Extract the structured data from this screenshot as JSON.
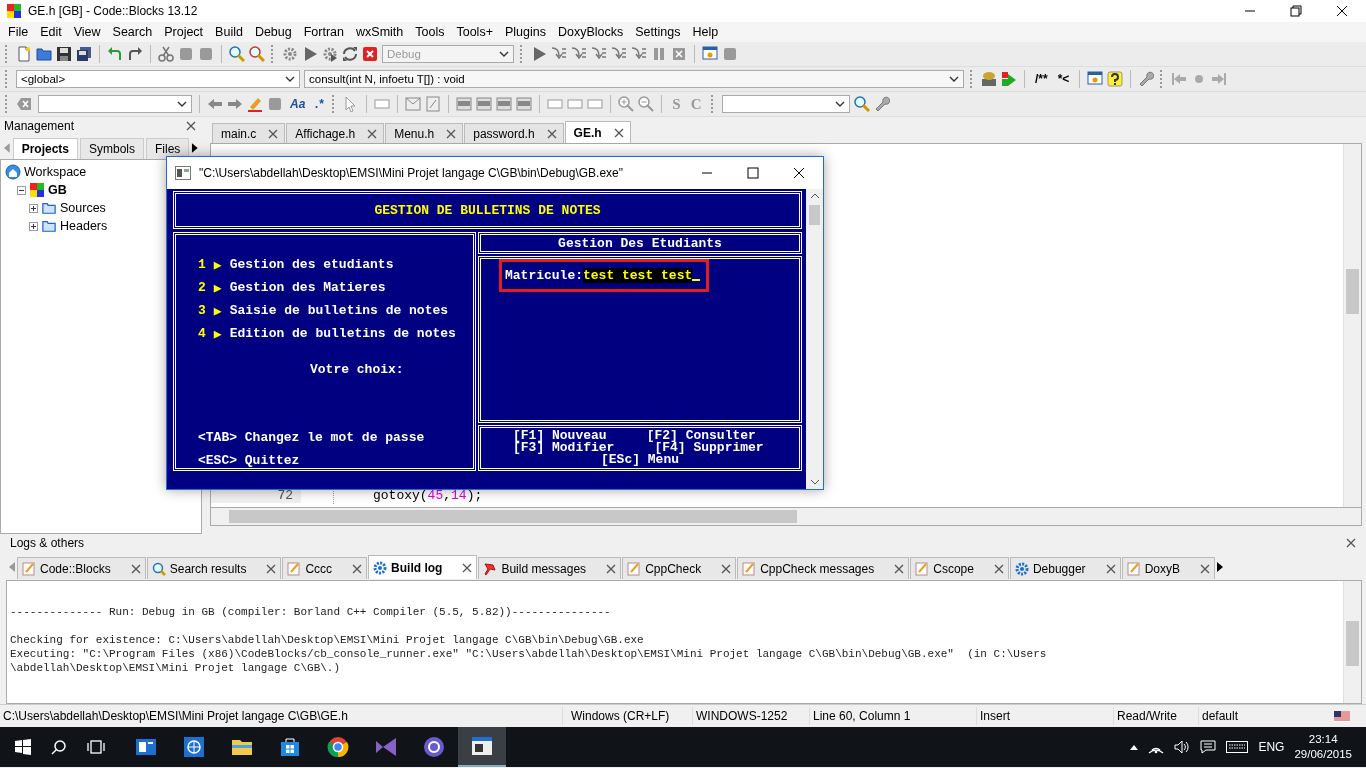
{
  "window": {
    "title": "GE.h [GB] - Code::Blocks 13.12"
  },
  "menu": [
    "File",
    "Edit",
    "View",
    "Search",
    "Project",
    "Build",
    "Debug",
    "Fortran",
    "wxSmith",
    "Tools",
    "Tools+",
    "Plugins",
    "DoxyBlocks",
    "Settings",
    "Help"
  ],
  "toolbar": {
    "build_target": "Debug",
    "scope": "<global>",
    "function": "consult(int N, infoetu T[]) : void",
    "doxy_block": "/**",
    "doxy_line": "*<",
    "match_case": "Aa",
    "regex": ".*",
    "search_s": "S",
    "search_c": "C"
  },
  "management": {
    "title": "Management",
    "tabs": [
      {
        "label": "Projects",
        "selected": true
      },
      {
        "label": "Symbols",
        "selected": false
      },
      {
        "label": "Files",
        "selected": false
      }
    ],
    "tree": [
      {
        "label": "Workspace",
        "kind": "workspace",
        "children": [
          {
            "label": "GB",
            "kind": "project",
            "expanded": true,
            "children": [
              {
                "label": "Sources",
                "kind": "folder",
                "expanded": false
              },
              {
                "label": "Headers",
                "kind": "folder",
                "expanded": false
              }
            ]
          }
        ]
      }
    ]
  },
  "editor": {
    "tabs": [
      {
        "label": "main.c",
        "selected": false
      },
      {
        "label": "Affichage.h",
        "selected": false
      },
      {
        "label": "Menu.h",
        "selected": false
      },
      {
        "label": "password.h",
        "selected": false
      },
      {
        "label": "GE.h",
        "selected": true
      }
    ],
    "lines": [
      {
        "number": "72",
        "code": "gotoxy(45,14);"
      }
    ]
  },
  "console": {
    "title": "\"C:\\Users\\abdellah\\Desktop\\EMSI\\Mini Projet langage C\\GB\\bin\\Debug\\GB.exe\"",
    "header": "GESTION DE BULLETINS DE NOTES",
    "menu_items": [
      {
        "number": "1",
        "arrow": "▶",
        "label": "Gestion des etudiants"
      },
      {
        "number": "2",
        "arrow": "▶",
        "label": "Gestion des Matieres"
      },
      {
        "number": "3",
        "arrow": "▶",
        "label": "Saisie de bulletins de notes"
      },
      {
        "number": "4",
        "arrow": "▶",
        "label": "Edition de bulletins de notes"
      }
    ],
    "prompt": "Votre choix:",
    "footer": [
      "<TAB> Changez le mot de passe",
      "<ESC> Quittez"
    ],
    "panel_title": "Gestion Des Etudiants",
    "field": {
      "label": "Matricule:",
      "value": "test test test",
      "highlighted": true
    },
    "shortcuts": [
      [
        "[F1] Nouveau",
        "[F2] Consulter"
      ],
      [
        "[F3] Modifier",
        "[F4] Supprimer"
      ],
      [
        "[ESc] Menu"
      ]
    ]
  },
  "logs": {
    "title": "Logs & others",
    "tabs": [
      {
        "label": "Code::Blocks",
        "kind": "note",
        "selected": false
      },
      {
        "label": "Search results",
        "kind": "search",
        "selected": false
      },
      {
        "label": "Cccc",
        "kind": "note",
        "selected": false
      },
      {
        "label": "Build log",
        "kind": "process",
        "selected": true
      },
      {
        "label": "Build messages",
        "kind": "message",
        "selected": false
      },
      {
        "label": "CppCheck",
        "kind": "note",
        "selected": false
      },
      {
        "label": "CppCheck messages",
        "kind": "note",
        "selected": false
      },
      {
        "label": "Cscope",
        "kind": "note",
        "selected": false
      },
      {
        "label": "Debugger",
        "kind": "process",
        "selected": false
      },
      {
        "label": "DoxyB",
        "kind": "note",
        "selected": false
      }
    ],
    "lines": [
      "-------------- Run: Debug in GB (compiler: Borland C++ Compiler (5.5, 5.82))---------------",
      "Checking for existence: C:\\Users\\abdellah\\Desktop\\EMSI\\Mini Projet langage C\\GB\\bin\\Debug\\GB.exe",
      "Executing: \"C:\\Program Files (x86)\\CodeBlocks/cb_console_runner.exe\" \"C:\\Users\\abdellah\\Desktop\\EMSI\\Mini Projet langage C\\GB\\bin\\Debug\\GB.exe\"  (in C:\\Users",
      "\\abdellah\\Desktop\\EMSI\\Mini Projet langage C\\GB\\.)"
    ]
  },
  "status_bar": [
    "C:\\Users\\abdellah\\Desktop\\EMSI\\Mini Projet langage C\\GB\\GE.h",
    "Windows (CR+LF)",
    "WINDOWS-1252",
    "Line 60, Column 1",
    "Insert",
    "Read/Write",
    "default"
  ],
  "taskbar": {
    "apps": [
      {
        "selected": false
      },
      {
        "selected": false
      },
      {
        "selected": false
      },
      {
        "selected": false
      },
      {
        "selected": false
      },
      {
        "selected": false
      },
      {
        "selected": false
      },
      {
        "selected": true
      }
    ],
    "language": "ENG",
    "time": "23:14",
    "date": "29/06/2015"
  }
}
